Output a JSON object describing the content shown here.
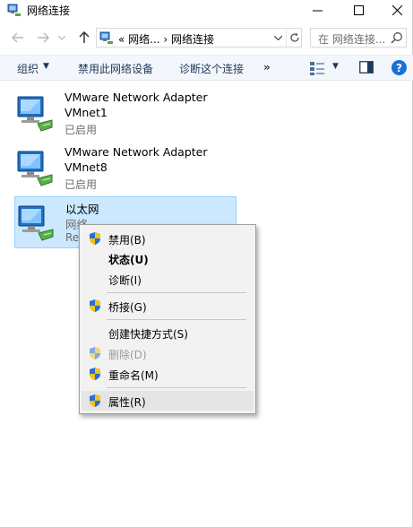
{
  "window": {
    "title": "网络连接",
    "minimize_symbol": "—",
    "maximize_symbol": "☐",
    "close_symbol": "✕"
  },
  "nav": {
    "back_icon": "arrow-left-icon",
    "forward_icon": "arrow-right-icon",
    "up_icon": "arrow-up-icon",
    "address": "«  网络...  ›  网络连接",
    "search_placeholder": "在 网络连接...",
    "refresh_icon": "refresh-icon"
  },
  "toolbar": {
    "organize": "组织",
    "disable_device": "禁用此网络设备",
    "diagnose": "诊断这个连接",
    "more": "»",
    "help": "?"
  },
  "items": [
    {
      "name": "VMware Network Adapter",
      "line2": "VMnet1",
      "status": "已启用"
    },
    {
      "name": "VMware Network Adapter",
      "line2": "VMnet8",
      "status": "已启用"
    },
    {
      "name": "以太网",
      "line2": "网络",
      "status": "Re"
    }
  ],
  "context_menu": {
    "items": [
      {
        "label": "禁用(B)",
        "icon": "shield-icon"
      },
      {
        "label": "状态(U)",
        "bold": true
      },
      {
        "label": "诊断(I)"
      },
      {
        "label": "桥接(G)",
        "icon": "shield-icon"
      },
      {
        "label": "创建快捷方式(S)"
      },
      {
        "label": "删除(D)",
        "icon": "shield-icon",
        "disabled": true
      },
      {
        "label": "重命名(M)",
        "icon": "shield-icon"
      },
      {
        "label": "属性(R)",
        "icon": "shield-icon",
        "highlighted": true
      }
    ]
  },
  "colors": {
    "selection_bg": "#cce8ff",
    "selection_border": "#99d1ff",
    "toolbar_text": "#1e395b",
    "help_blue": "#1a6fd8"
  }
}
